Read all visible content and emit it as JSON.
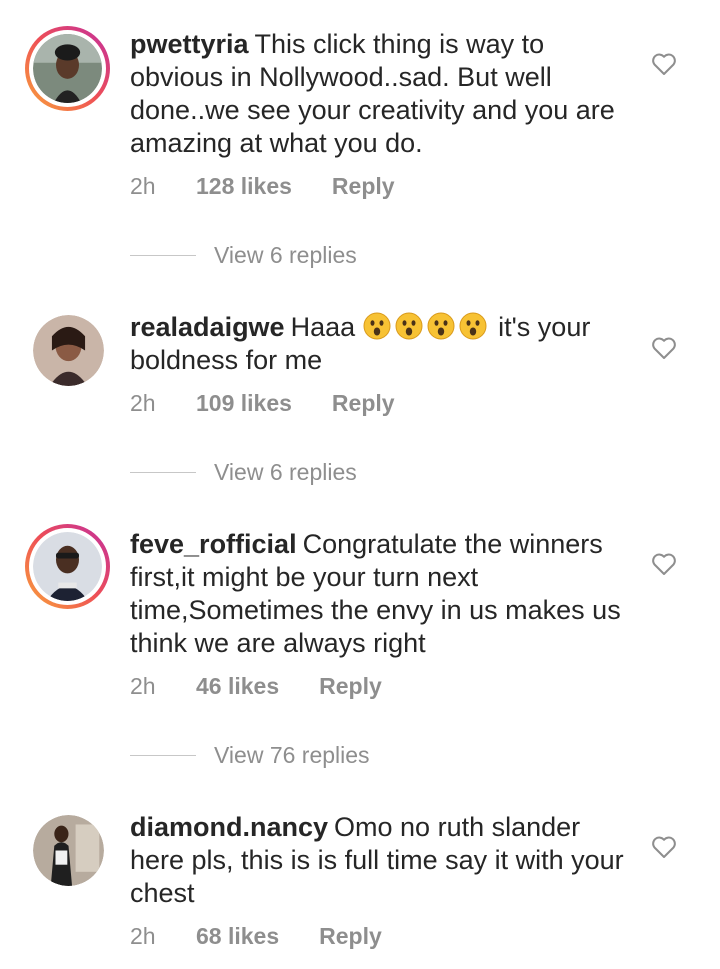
{
  "comments": [
    {
      "username": "pwettyria",
      "text": "This click thing is way to obvious in Nollywood..sad. But well done..we see your creativity and you are amazing at what you do.",
      "time": "2h",
      "likes": "128 likes",
      "reply_label": "Reply",
      "view_replies": "View 6 replies",
      "has_story": true
    },
    {
      "username": "realadaigwe",
      "text_before": "Haaa",
      "emojis": [
        "astonished-face-emoji",
        "astonished-face-emoji",
        "astonished-face-emoji",
        "astonished-face-emoji"
      ],
      "text_after": " it's your boldness for me",
      "time": "2h",
      "likes": "109 likes",
      "reply_label": "Reply",
      "view_replies": "View 6 replies",
      "has_story": false
    },
    {
      "username": "feve_rofficial",
      "text": "Congratulate the winners first,it might be your turn next time,Sometimes the envy in us makes us think we are always right",
      "time": "2h",
      "likes": "46 likes",
      "reply_label": "Reply",
      "view_replies": "View 76 replies",
      "has_story": true
    },
    {
      "username": "diamond.nancy",
      "text": "Omo no ruth slander here pls, this is is full time say it with your chest",
      "time": "2h",
      "likes": "68 likes",
      "reply_label": "Reply",
      "has_story": false
    }
  ],
  "colors": {
    "text": "#262626",
    "secondary": "#8e8e8e",
    "story_ring_start": "#f9a53a",
    "story_ring_end": "#c22e9f"
  }
}
